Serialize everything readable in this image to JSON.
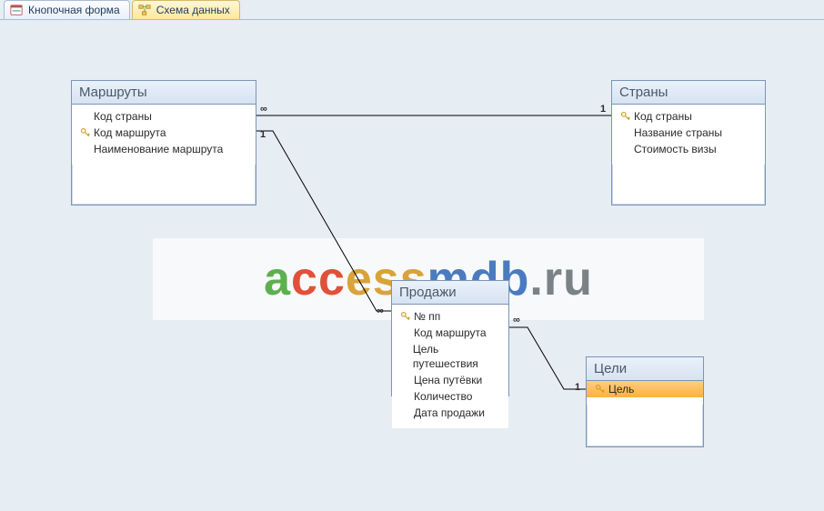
{
  "tabs": {
    "form": {
      "label": "Кнопочная форма"
    },
    "schema": {
      "label": "Схема данных"
    }
  },
  "watermark": "accessmdb.ru",
  "tables": {
    "routes": {
      "title": "Маршруты",
      "fields": [
        {
          "label": "Код страны",
          "pk": false
        },
        {
          "label": "Код маршрута",
          "pk": true
        },
        {
          "label": "Наименование маршрута",
          "pk": false
        }
      ]
    },
    "countries": {
      "title": "Страны",
      "fields": [
        {
          "label": "Код страны",
          "pk": true
        },
        {
          "label": "Название страны",
          "pk": false
        },
        {
          "label": "Стоимость визы",
          "pk": false
        }
      ]
    },
    "sales": {
      "title": "Продажи",
      "fields": [
        {
          "label": "№ пп",
          "pk": true
        },
        {
          "label": "Код маршрута",
          "pk": false
        },
        {
          "label": "Цель путешествия",
          "pk": false
        },
        {
          "label": "Цена путёвки",
          "pk": false
        },
        {
          "label": "Количество",
          "pk": false
        },
        {
          "label": "Дата продажи",
          "pk": false
        }
      ]
    },
    "goals": {
      "title": "Цели",
      "fields": [
        {
          "label": "Цель",
          "pk": true,
          "selected": true
        }
      ]
    }
  },
  "relations": {
    "routes_countries": {
      "left": "∞",
      "right": "1"
    },
    "routes_sales": {
      "left": "1",
      "right": "∞"
    },
    "sales_goals": {
      "left": "∞",
      "right": "1"
    }
  }
}
